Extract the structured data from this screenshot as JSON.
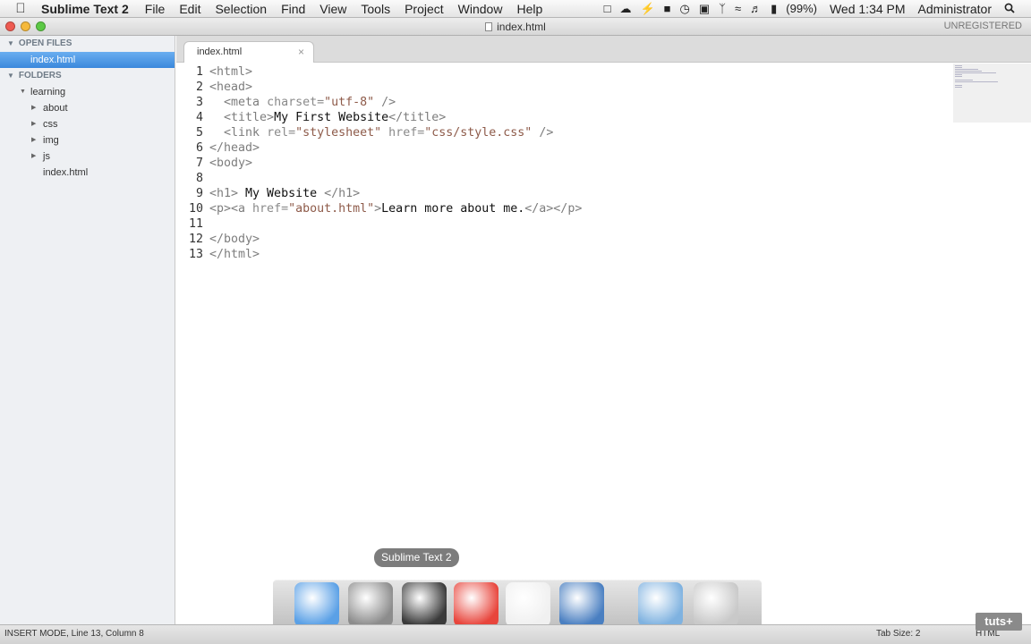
{
  "menubar": {
    "apple_icon": "apple-logo-icon",
    "app_name": "Sublime Text 2",
    "menus": [
      "File",
      "Edit",
      "Selection",
      "Find",
      "View",
      "Tools",
      "Project",
      "Window",
      "Help"
    ],
    "battery": "(99%)",
    "clock": "Wed 1:34 PM",
    "user": "Administrator"
  },
  "window": {
    "title": "index.html",
    "license": "UNREGISTERED"
  },
  "sidebar": {
    "open_files_label": "OPEN FILES",
    "open_files": [
      "index.html"
    ],
    "folders_label": "FOLDERS",
    "root_folder": "learning",
    "subfolders": [
      "about",
      "css",
      "img",
      "js"
    ],
    "root_files": [
      "index.html"
    ]
  },
  "tab": {
    "label": "index.html",
    "close": "×"
  },
  "code": [
    {
      "n": "1",
      "tokens": [
        {
          "t": "<html>",
          "k": "tag"
        }
      ]
    },
    {
      "n": "2",
      "tokens": [
        {
          "t": "<head>",
          "k": "tag"
        }
      ]
    },
    {
      "n": "3",
      "tokens": [
        {
          "t": "  ",
          "k": "txt"
        },
        {
          "t": "<meta ",
          "k": "tag"
        },
        {
          "t": "charset=",
          "k": "attr"
        },
        {
          "t": "\"utf-8\"",
          "k": "str"
        },
        {
          "t": " />",
          "k": "tag"
        }
      ]
    },
    {
      "n": "4",
      "tokens": [
        {
          "t": "  ",
          "k": "txt"
        },
        {
          "t": "<title>",
          "k": "tag"
        },
        {
          "t": "My First Website",
          "k": "txt"
        },
        {
          "t": "</title>",
          "k": "tag"
        }
      ]
    },
    {
      "n": "5",
      "tokens": [
        {
          "t": "  ",
          "k": "txt"
        },
        {
          "t": "<link ",
          "k": "tag"
        },
        {
          "t": "rel=",
          "k": "attr"
        },
        {
          "t": "\"stylesheet\"",
          "k": "str"
        },
        {
          "t": " href=",
          "k": "attr"
        },
        {
          "t": "\"css/style.css\"",
          "k": "str"
        },
        {
          "t": " />",
          "k": "tag"
        }
      ]
    },
    {
      "n": "6",
      "tokens": [
        {
          "t": "</head>",
          "k": "tag"
        }
      ]
    },
    {
      "n": "7",
      "tokens": [
        {
          "t": "<body>",
          "k": "tag"
        }
      ]
    },
    {
      "n": "8",
      "tokens": []
    },
    {
      "n": "9",
      "tokens": [
        {
          "t": "<h1>",
          "k": "tag"
        },
        {
          "t": " My Website ",
          "k": "txt"
        },
        {
          "t": "</h1>",
          "k": "tag"
        }
      ]
    },
    {
      "n": "10",
      "tokens": [
        {
          "t": "<p><a ",
          "k": "tag"
        },
        {
          "t": "href=",
          "k": "attr"
        },
        {
          "t": "\"about.html\"",
          "k": "str"
        },
        {
          "t": ">",
          "k": "tag"
        },
        {
          "t": "Learn more about me.",
          "k": "txt"
        },
        {
          "t": "</a></p>",
          "k": "tag"
        }
      ]
    },
    {
      "n": "11",
      "tokens": []
    },
    {
      "n": "12",
      "tokens": [
        {
          "t": "</body>",
          "k": "tag"
        }
      ]
    },
    {
      "n": "13",
      "tokens": [
        {
          "t": "</html>",
          "k": "tag"
        }
      ]
    }
  ],
  "dock": {
    "tooltip": "Sublime Text 2",
    "items": [
      {
        "name": "finder",
        "icon": "finder-icon",
        "color": "#5aa0e6",
        "running": true
      },
      {
        "name": "launchpad",
        "icon": "launchpad-rocket-icon",
        "color": "#8c8c8c",
        "running": false
      },
      {
        "name": "sublime-text",
        "icon": "sublime-text-icon",
        "color": "#3a3a3a",
        "running": true
      },
      {
        "name": "chrome",
        "icon": "chrome-icon",
        "color": "#e8453c",
        "running": true
      },
      {
        "name": "mouse-app",
        "icon": "mouse-icon",
        "color": "#f0f0f0",
        "running": true
      },
      {
        "name": "video-app",
        "icon": "film-clapper-icon",
        "color": "#4a7fc1",
        "running": true
      },
      {
        "name": "applications",
        "icon": "applications-folder-icon",
        "color": "#7fb2e0",
        "running": false
      },
      {
        "name": "trash",
        "icon": "trash-icon",
        "color": "#c9c9c9",
        "running": false
      }
    ]
  },
  "statusbar": {
    "left": "INSERT MODE, Line 13, Column 8",
    "tab_size": "Tab Size: 2",
    "syntax": "HTML"
  },
  "watermark": "tuts+"
}
